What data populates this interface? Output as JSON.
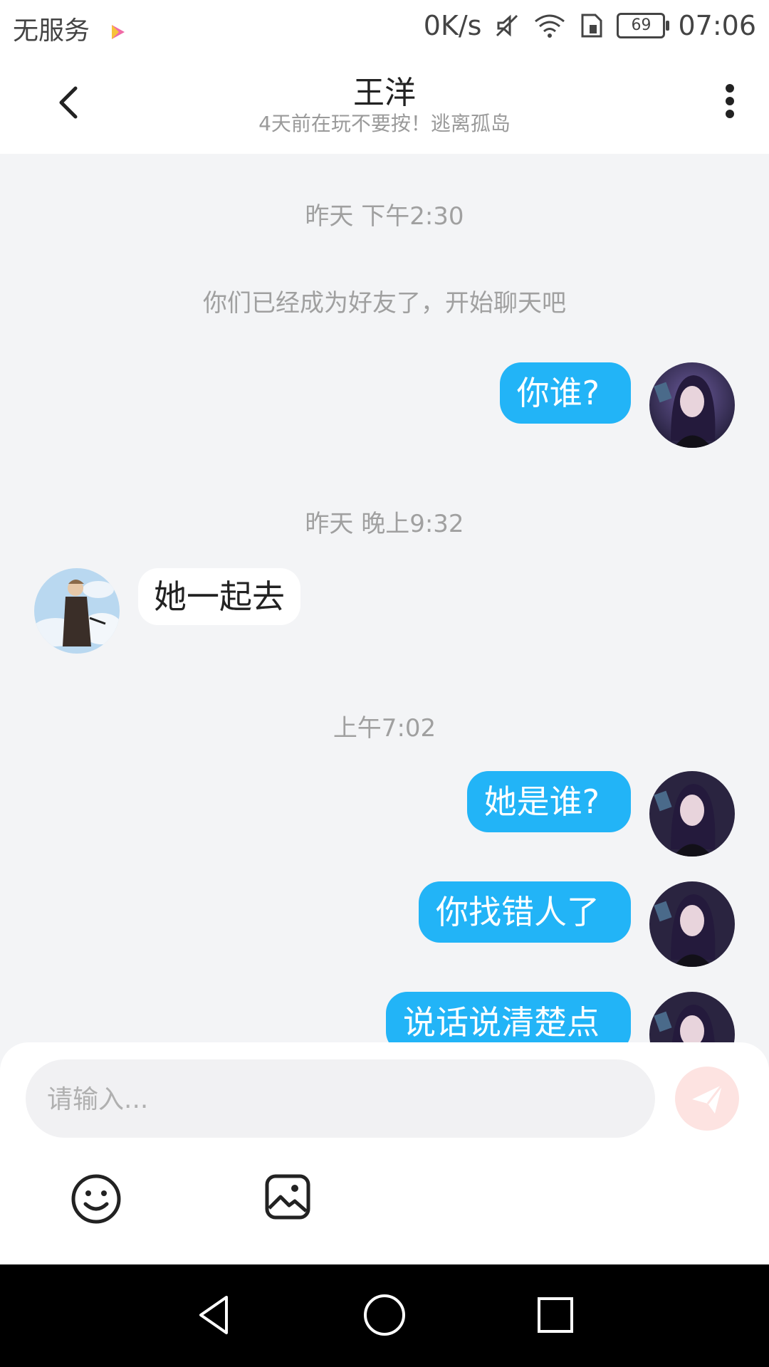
{
  "status_bar": {
    "carrier": "无服务",
    "speed": "0K/s",
    "battery": "69",
    "time": "07:06"
  },
  "header": {
    "title": "王洋",
    "subtitle": "4天前在玩不要按！逃离孤岛"
  },
  "chat": {
    "ts1": "昨天 下午2:30",
    "system_msg": "你们已经成为好友了，开始聊天吧",
    "msg1": "你谁?",
    "ts2": "昨天 晚上9:32",
    "msg2": "她一起去",
    "ts3": "上午7:02",
    "msg3": "她是谁?",
    "msg4": "你找错人了",
    "msg5": "说话说清楚点"
  },
  "composer": {
    "placeholder": "请输入..."
  },
  "colors": {
    "outgoing_bubble": "#22b4f7",
    "send_button": "#fde3e1",
    "background": "#f3f4f6"
  },
  "icons": [
    "back-arrow-icon",
    "more-vertical-icon",
    "send-plane-icon",
    "emoji-icon",
    "image-icon",
    "nav-back-icon",
    "nav-home-icon",
    "nav-recents-icon"
  ]
}
